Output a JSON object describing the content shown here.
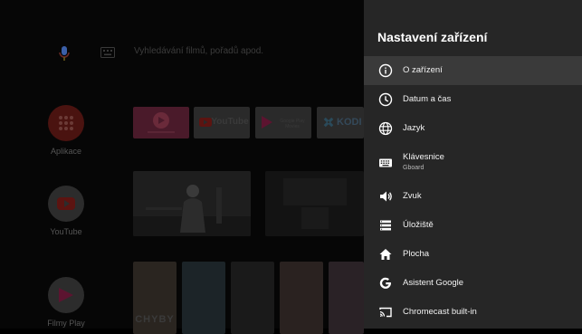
{
  "home": {
    "search_placeholder": "Vyhledávání filmů, pořadů apod.",
    "apps": [
      {
        "label": "Aplikace"
      },
      {
        "label": "YouTube"
      },
      {
        "label": "Filmy Play"
      }
    ],
    "channels": [
      "",
      "YouTube",
      "Google Play Movies",
      "KODI"
    ],
    "posters": [
      "CHYBY",
      "",
      "",
      "",
      ""
    ]
  },
  "settings": {
    "title": "Nastavení zařízení",
    "items": [
      {
        "label": "O zařízení",
        "icon": "info-icon"
      },
      {
        "label": "Datum a čas",
        "icon": "clock-icon"
      },
      {
        "label": "Jazyk",
        "icon": "globe-icon"
      },
      {
        "label": "Klávesnice",
        "sublabel": "Gboard",
        "icon": "keyboard-icon"
      },
      {
        "label": "Zvuk",
        "icon": "speaker-icon"
      },
      {
        "label": "Úložiště",
        "icon": "storage-icon"
      },
      {
        "label": "Plocha",
        "icon": "home-icon"
      },
      {
        "label": "Asistent Google",
        "icon": "google-icon"
      },
      {
        "label": "Chromecast built-in",
        "icon": "cast-icon"
      }
    ]
  },
  "colors": {
    "panel_bg": "#262626",
    "selected_bg": "#3a3a3a",
    "apps_red": "#5a1410"
  }
}
